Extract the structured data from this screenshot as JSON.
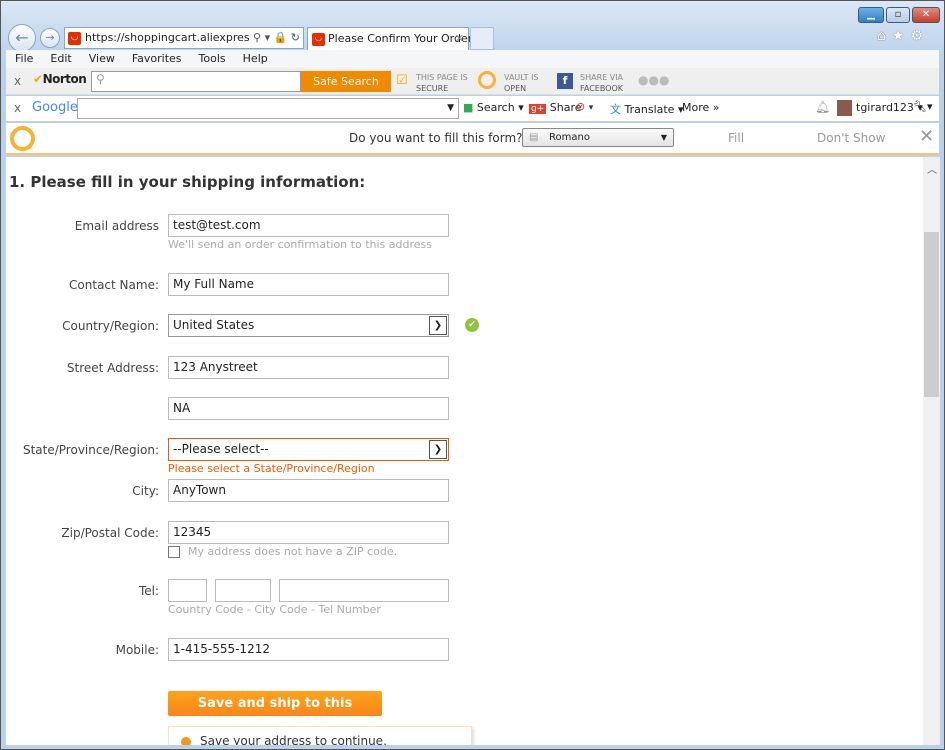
{
  "browser": {
    "url": "https://shoppingcart.aliexpress.com/",
    "tab_title": "Please Confirm Your Order ...",
    "menu": [
      "File",
      "Edit",
      "View",
      "Favorites",
      "Tools",
      "Help"
    ]
  },
  "norton": {
    "brand": "Norton",
    "safe_search": "Safe Search",
    "secure_l1": "THIS PAGE IS",
    "secure_l2": "SECURE",
    "vault_l1": "VAULT IS",
    "vault_l2": "OPEN",
    "fb_l1": "SHARE VIA",
    "fb_l2": "FACEBOOK"
  },
  "google": {
    "brand": "Google",
    "search": "Search",
    "share": "Share",
    "translate": "Translate",
    "more": "More »",
    "user": "tgirard123"
  },
  "fillbar": {
    "question": "Do you want to fill this form?",
    "identity": "Romano",
    "fill": "Fill",
    "dont_show": "Don't Show"
  },
  "form": {
    "heading": "1. Please fill in your shipping information:",
    "email_label": "Email address",
    "email": "test@test.com",
    "email_hint": "We'll send an order confirmation to this address",
    "contact_label": "Contact Name:",
    "contact": "My Full Name",
    "country_label": "Country/Region:",
    "country": "United States",
    "street_label": "Street Address:",
    "street1": "123 Anystreet",
    "street2": "NA",
    "state_label": "State/Province/Region:",
    "state": "--Please select--",
    "state_error": "Please select a State/Province/Region",
    "city_label": "City:",
    "city": "AnyTown",
    "zip_label": "Zip/Postal Code:",
    "zip": "12345",
    "nozip": "My address does not have a ZIP code.",
    "tel_label": "Tel:",
    "tel_hint": "Country Code - City Code - Tel Number",
    "mobile_label": "Mobile:",
    "mobile": "1-415-555-1212",
    "save_button": "Save and ship to this address",
    "tooltip": "Save your address to continue."
  },
  "colors": {
    "accent": "#f7941d",
    "error": "#f05a00",
    "ok": "#8cc63f"
  }
}
